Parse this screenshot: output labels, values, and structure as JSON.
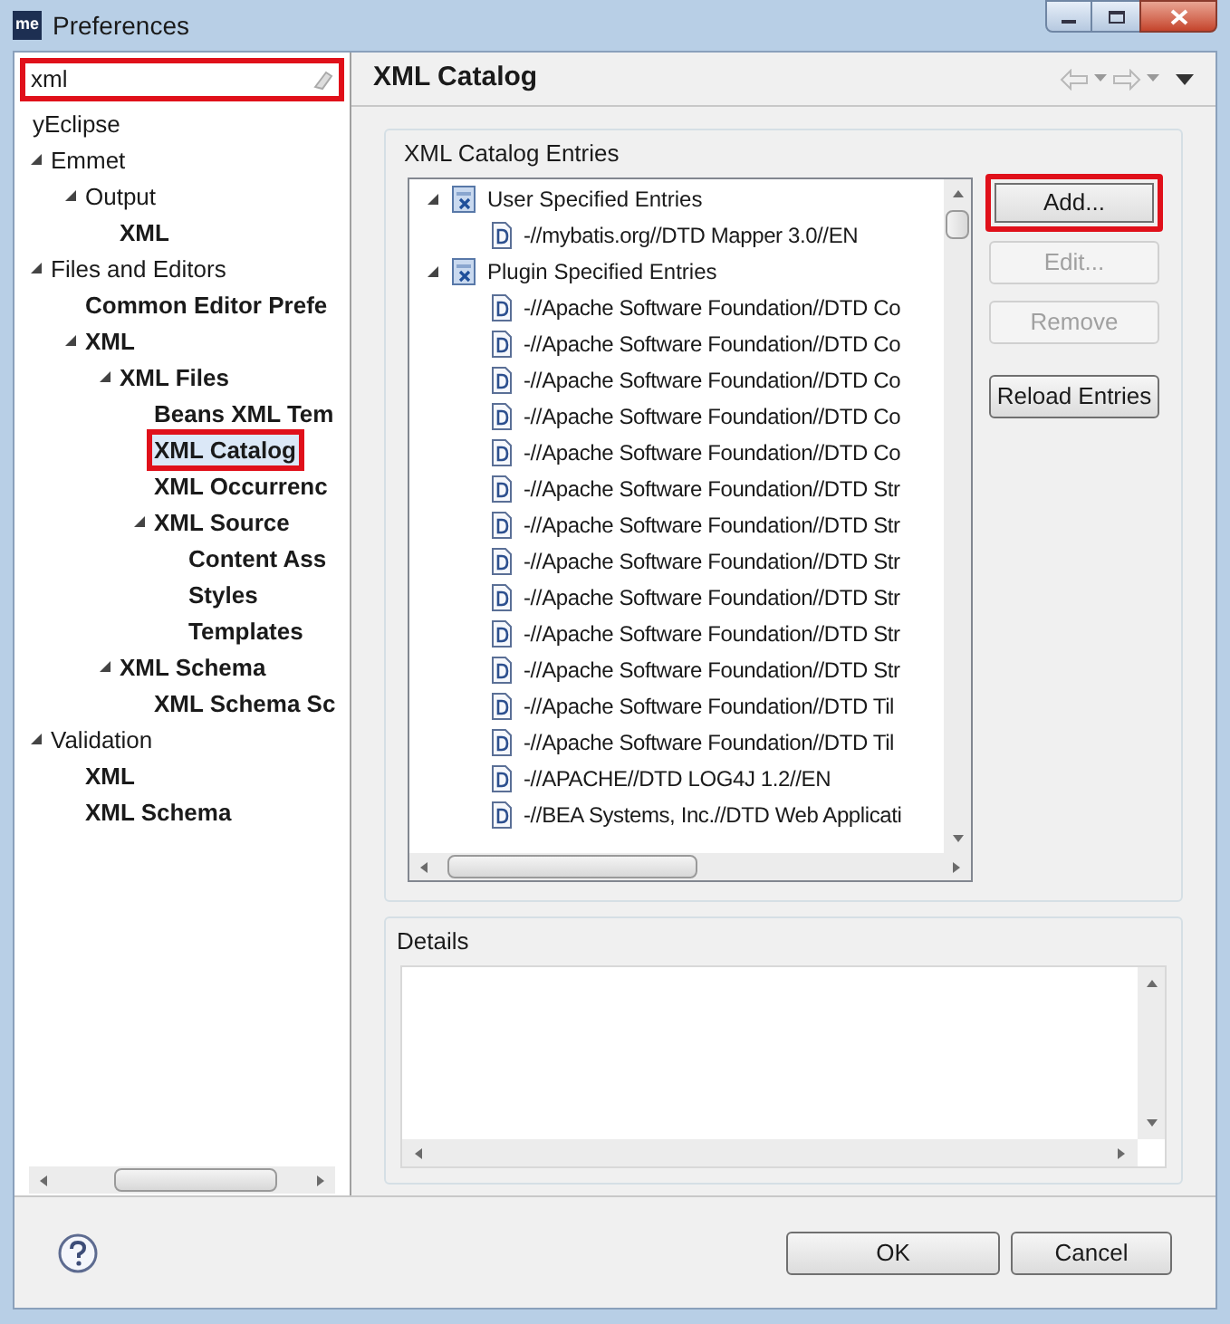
{
  "window": {
    "title": "Preferences",
    "icon_text": "me"
  },
  "filter": {
    "value": "xml",
    "highlighted": true
  },
  "tree": [
    {
      "label": "yEclipse",
      "matched": false,
      "selected": false,
      "highlighted": false
    },
    {
      "label": "Emmet",
      "matched": false,
      "selected": false,
      "highlighted": false,
      "expanded": true,
      "children": [
        {
          "label": "Output",
          "matched": false,
          "selected": false,
          "highlighted": false,
          "expanded": true,
          "children": [
            {
              "label": "XML",
              "matched": true,
              "selected": false,
              "highlighted": false
            }
          ]
        }
      ]
    },
    {
      "label": "Files and Editors",
      "matched": false,
      "selected": false,
      "highlighted": false,
      "expanded": true,
      "children": [
        {
          "label": "Common Editor Prefe",
          "matched": true,
          "selected": false,
          "highlighted": false
        },
        {
          "label": "XML",
          "matched": true,
          "selected": false,
          "highlighted": false,
          "expanded": true,
          "children": [
            {
              "label": "XML Files",
              "matched": true,
              "selected": false,
              "highlighted": false,
              "expanded": true,
              "children": [
                {
                  "label": "Beans XML Tem",
                  "matched": true,
                  "selected": false,
                  "highlighted": false
                },
                {
                  "label": "XML Catalog",
                  "matched": true,
                  "selected": true,
                  "highlighted": true
                },
                {
                  "label": "XML Occurrenc",
                  "matched": true,
                  "selected": false,
                  "highlighted": false
                },
                {
                  "label": "XML Source",
                  "matched": true,
                  "selected": false,
                  "highlighted": false,
                  "expanded": true,
                  "children": [
                    {
                      "label": "Content Ass",
                      "matched": true,
                      "selected": false,
                      "highlighted": false
                    },
                    {
                      "label": "Styles",
                      "matched": true,
                      "selected": false,
                      "highlighted": false
                    },
                    {
                      "label": "Templates",
                      "matched": true,
                      "selected": false,
                      "highlighted": false
                    }
                  ]
                }
              ]
            },
            {
              "label": "XML Schema",
              "matched": true,
              "selected": false,
              "highlighted": false,
              "expanded": true,
              "children": [
                {
                  "label": "XML Schema Sc",
                  "matched": true,
                  "selected": false,
                  "highlighted": false
                }
              ]
            }
          ]
        }
      ]
    },
    {
      "label": "Validation",
      "matched": false,
      "selected": false,
      "highlighted": false,
      "expanded": true,
      "children": [
        {
          "label": "XML",
          "matched": true,
          "selected": false,
          "highlighted": false
        },
        {
          "label": "XML Schema",
          "matched": true,
          "selected": false,
          "highlighted": false
        }
      ]
    }
  ],
  "page": {
    "title": "XML Catalog",
    "entries_group": {
      "title": "XML Catalog Entries",
      "entries": [
        {
          "label": "User Specified Entries",
          "expanded": true,
          "children": [
            {
              "label": "-//mybatis.org//DTD Mapper 3.0//EN"
            }
          ]
        },
        {
          "label": "Plugin Specified Entries",
          "expanded": true,
          "children": [
            {
              "label": "-//Apache Software Foundation//DTD Co"
            },
            {
              "label": "-//Apache Software Foundation//DTD Co"
            },
            {
              "label": "-//Apache Software Foundation//DTD Co"
            },
            {
              "label": "-//Apache Software Foundation//DTD Co"
            },
            {
              "label": "-//Apache Software Foundation//DTD Co"
            },
            {
              "label": "-//Apache Software Foundation//DTD Str"
            },
            {
              "label": "-//Apache Software Foundation//DTD Str"
            },
            {
              "label": "-//Apache Software Foundation//DTD Str"
            },
            {
              "label": "-//Apache Software Foundation//DTD Str"
            },
            {
              "label": "-//Apache Software Foundation//DTD Str"
            },
            {
              "label": "-//Apache Software Foundation//DTD Str"
            },
            {
              "label": "-//Apache Software Foundation//DTD Til"
            },
            {
              "label": "-//Apache Software Foundation//DTD Til"
            },
            {
              "label": "-//APACHE//DTD LOG4J 1.2//EN"
            },
            {
              "label": "-//BEA Systems, Inc.//DTD Web Applicati"
            }
          ]
        }
      ],
      "buttons": [
        {
          "label": "Add...",
          "disabled": false,
          "highlighted": true
        },
        {
          "label": "Edit...",
          "disabled": true,
          "highlighted": false
        },
        {
          "label": "Remove",
          "disabled": true,
          "highlighted": false
        },
        {
          "label": "Reload Entries",
          "disabled": false,
          "highlighted": false
        }
      ]
    },
    "details_group": {
      "title": "Details"
    }
  },
  "buttons": [
    "OK",
    "Cancel"
  ]
}
